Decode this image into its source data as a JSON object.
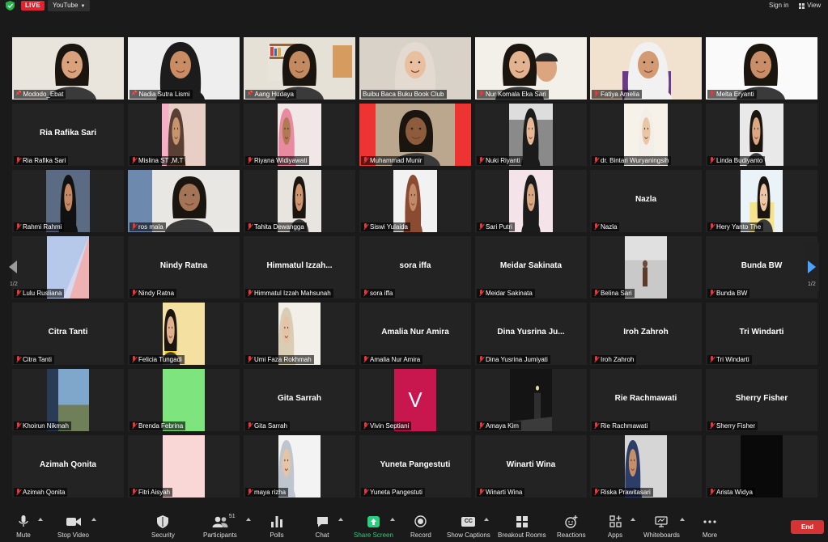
{
  "topbar": {
    "live_label": "LIVE",
    "stream_target": "YouTube",
    "signin_label": "Sign in",
    "view_label": "View"
  },
  "pagination": {
    "left_page": "1/2",
    "right_page": "1/2"
  },
  "participants": [
    {
      "name": "Mododo_Ebat",
      "display": "",
      "pinned": true,
      "muted": false
    },
    {
      "name": "Nadia Sutra Lismi",
      "display": "",
      "pinned": true,
      "muted": false
    },
    {
      "name": "Aang Hudaya",
      "display": "",
      "pinned": true,
      "muted": false
    },
    {
      "name": "Buibu Baca Buku Book Club",
      "display": "",
      "pinned": false,
      "muted": false
    },
    {
      "name": "Nur Komala Eka Sari",
      "display": "",
      "pinned": false,
      "muted": true
    },
    {
      "name": "Fatiya Amelia",
      "display": "",
      "pinned": false,
      "muted": true
    },
    {
      "name": "Melta Eryanti",
      "display": "",
      "pinned": false,
      "muted": true
    },
    {
      "name": "Ria Rafika Sari",
      "display": "Ria Rafika Sari",
      "pinned": false,
      "muted": true
    },
    {
      "name": "Mislina ST ,M.T",
      "display": "",
      "pinned": false,
      "muted": true
    },
    {
      "name": "Riyana Widiyawati",
      "display": "",
      "pinned": false,
      "muted": true
    },
    {
      "name": "Muhammad Munir",
      "display": "",
      "pinned": false,
      "muted": true
    },
    {
      "name": "Nuki Riyanti",
      "display": "",
      "pinned": false,
      "muted": true
    },
    {
      "name": "dr. Bintari Wuryaningsih",
      "display": "",
      "pinned": false,
      "muted": true
    },
    {
      "name": "Linda Budiyanto",
      "display": "",
      "pinned": false,
      "muted": true
    },
    {
      "name": "Rahmi Rahmi",
      "display": "",
      "pinned": false,
      "muted": true
    },
    {
      "name": "ros mala",
      "display": "",
      "pinned": false,
      "muted": true
    },
    {
      "name": "Tahita Dewangga",
      "display": "",
      "pinned": false,
      "muted": true
    },
    {
      "name": "Siswi Yulaida",
      "display": "",
      "pinned": false,
      "muted": true
    },
    {
      "name": "Sari Putri",
      "display": "",
      "pinned": false,
      "muted": true
    },
    {
      "name": "Nazla",
      "display": "Nazla",
      "pinned": false,
      "muted": true
    },
    {
      "name": "Hery Yanto The",
      "display": "",
      "pinned": false,
      "muted": true
    },
    {
      "name": "Lulu Rusliana",
      "display": "",
      "pinned": false,
      "muted": true
    },
    {
      "name": "Nindy Ratna",
      "display": "Nindy Ratna",
      "pinned": false,
      "muted": true
    },
    {
      "name": "Himmatul Izzah Mahsunah",
      "display": "Himmatul Izzah...",
      "pinned": false,
      "muted": true
    },
    {
      "name": "sora iffa",
      "display": "sora iffa",
      "pinned": false,
      "muted": true
    },
    {
      "name": "Meidar Sakinata",
      "display": "Meidar Sakinata",
      "pinned": false,
      "muted": true
    },
    {
      "name": "Belina Sari",
      "display": "",
      "pinned": false,
      "muted": true
    },
    {
      "name": "Bunda BW",
      "display": "Bunda BW",
      "pinned": false,
      "muted": true
    },
    {
      "name": "Citra Tanti",
      "display": "Citra Tanti",
      "pinned": false,
      "muted": true
    },
    {
      "name": "Felicia Tungadi",
      "display": "",
      "pinned": false,
      "muted": true
    },
    {
      "name": "Umi Faza Rokhmah",
      "display": "",
      "pinned": false,
      "muted": true
    },
    {
      "name": "Amalia Nur Amira",
      "display": "Amalia Nur Amira",
      "pinned": false,
      "muted": true
    },
    {
      "name": "Dina Yusrina Jumiyati",
      "display": "Dina Yusrina Ju...",
      "pinned": false,
      "muted": true
    },
    {
      "name": "Iroh Zahroh",
      "display": "Iroh Zahroh",
      "pinned": false,
      "muted": true
    },
    {
      "name": "Tri Windarti",
      "display": "Tri Windarti",
      "pinned": false,
      "muted": true
    },
    {
      "name": "Khoirun Nikmah",
      "display": "",
      "pinned": false,
      "muted": true
    },
    {
      "name": "Brenda Febrina",
      "display": "",
      "pinned": false,
      "muted": true
    },
    {
      "name": "Gita Sarrah",
      "display": "Gita Sarrah",
      "pinned": false,
      "muted": true
    },
    {
      "name": "Vivin Septiani",
      "display": "",
      "avatar_letter": "V",
      "pinned": false,
      "muted": true
    },
    {
      "name": "Amaya Kim",
      "display": "",
      "pinned": false,
      "muted": true
    },
    {
      "name": "Rie Rachmawati",
      "display": "Rie Rachmawati",
      "pinned": false,
      "muted": true
    },
    {
      "name": "Sherry Fisher",
      "display": "Sherry Fisher",
      "pinned": false,
      "muted": true
    },
    {
      "name": "Azimah Qonita",
      "display": "Azimah Qonita",
      "pinned": false,
      "muted": true
    },
    {
      "name": "Fitri Aisyah",
      "display": "",
      "pinned": false,
      "muted": true
    },
    {
      "name": "maya rizha",
      "display": "",
      "pinned": false,
      "muted": true
    },
    {
      "name": "Yuneta Pangestuti",
      "display": "Yuneta Pangestuti",
      "pinned": false,
      "muted": true
    },
    {
      "name": "Winarti Wina",
      "display": "Winarti Wina",
      "pinned": false,
      "muted": true
    },
    {
      "name": "Riska Prawitasari",
      "display": "",
      "pinned": false,
      "muted": true
    },
    {
      "name": "Arista Widya",
      "display": "",
      "pinned": false,
      "muted": true
    }
  ],
  "toolbar": {
    "mute": "Mute",
    "stop_video": "Stop Video",
    "security": "Security",
    "participants": "Participants",
    "participants_count": "51",
    "polls": "Polls",
    "chat": "Chat",
    "share_screen": "Share Screen",
    "record": "Record",
    "show_captions": "Show Captions",
    "breakout_rooms": "Breakout Rooms",
    "reactions": "Reactions",
    "apps": "Apps",
    "whiteboards": "Whiteboards",
    "more": "More",
    "end": "End",
    "captions_icon_text": "CC"
  },
  "colors": {
    "live_red": "#e0242f",
    "active_speaker_outline": "#d9e35a",
    "share_green": "#26d07c",
    "end_red": "#d63434",
    "next_page_blue": "#4aa3ff",
    "avatar_v": "#c8174f",
    "avatar_green": "#7ee47e",
    "avatar_pink": "#f9d7d7"
  }
}
